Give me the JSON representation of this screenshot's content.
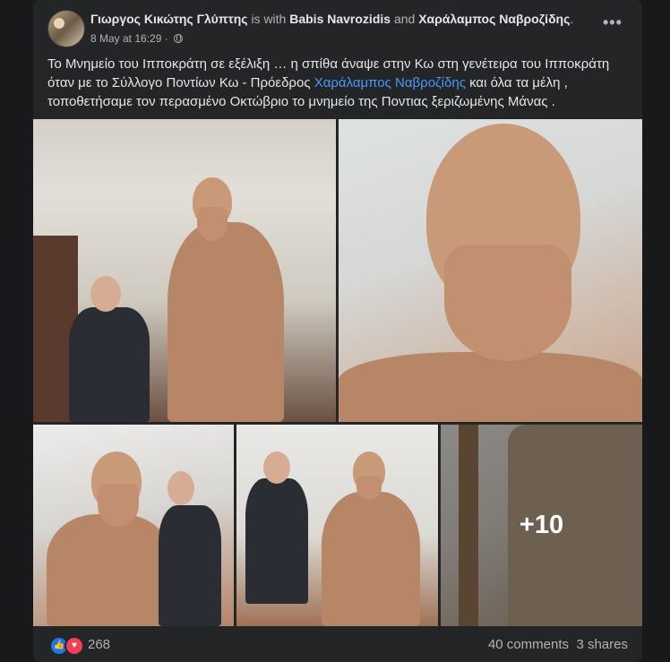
{
  "post": {
    "author": "Γιωργος Κικώτης Γλύπτης",
    "with_text": "is with",
    "tagged_1": "Babis Navrozidis",
    "and_text": "and",
    "tagged_2": "Χαράλαμπος Ναβροζίδης",
    "period": ".",
    "date": "8 May at 16:29",
    "separator": "·",
    "privacy_icon": "globe-icon",
    "more_icon": "more-options-icon",
    "text_part1": "Το Μνημείο του Ιπποκράτη σε εξέλιξη … η σπίθα άναψε στην Κω στη γενέτειρα του Ιπποκράτη όταν με το Σύλλογο Ποντίων Κω - Πρόεδρος ",
    "text_link": "Χαράλαμπος Ναβροζίδης",
    "text_part2": " και όλα τα μέλη , τοποθετήσαμε τον περασμένο Οκτώβριο το μνημείο της Ποντιας ξεριζωμένης Μάνας ."
  },
  "photos": {
    "more_count": "+10"
  },
  "footer": {
    "reactions_count": "268",
    "comments": "40 comments",
    "shares": "3 shares"
  },
  "colors": {
    "background": "#18191a",
    "card": "#242526",
    "link": "#4599ff",
    "like": "#1877f2",
    "love": "#f33e58"
  }
}
